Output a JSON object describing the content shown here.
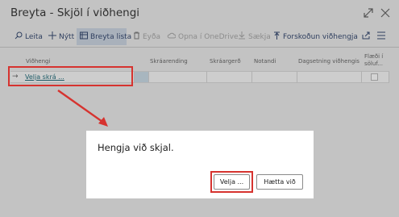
{
  "window": {
    "title": "Breyta - Skjöl í viðhengi",
    "expand_icon": "expand-icon",
    "close_icon": "close-icon"
  },
  "toolbar": {
    "items": [
      {
        "label": "Leita",
        "icon": "search-icon"
      },
      {
        "label": "Nýtt",
        "icon": "plus-icon"
      },
      {
        "label": "Breyta lista",
        "icon": "edit-list-icon"
      },
      {
        "label": "Eyða",
        "icon": "trash-icon"
      },
      {
        "label": "Opna í OneDrive",
        "icon": "cloud-icon"
      },
      {
        "label": "Sækja",
        "icon": "download-icon"
      },
      {
        "label": "Forskoðun viðhengja",
        "icon": "pin-icon"
      }
    ],
    "share_icon": "share-icon",
    "menu_icon": "list-menu-icon"
  },
  "grid": {
    "columns": [
      "Viðhengi",
      "Skráarending",
      "Skráargerð",
      "Notandi",
      "Dagsetning viðhengis",
      "Flæði í söluf..."
    ],
    "row": {
      "link_text": "Velja skrá ...",
      "arrow": "→"
    }
  },
  "dialog": {
    "message": "Hengja við skjal.",
    "ok_label": "Velja ...",
    "cancel_label": "Hætta við"
  },
  "colors": {
    "highlight": "#d6332f",
    "link": "#1e5c68",
    "background": "#c3c3c3"
  }
}
